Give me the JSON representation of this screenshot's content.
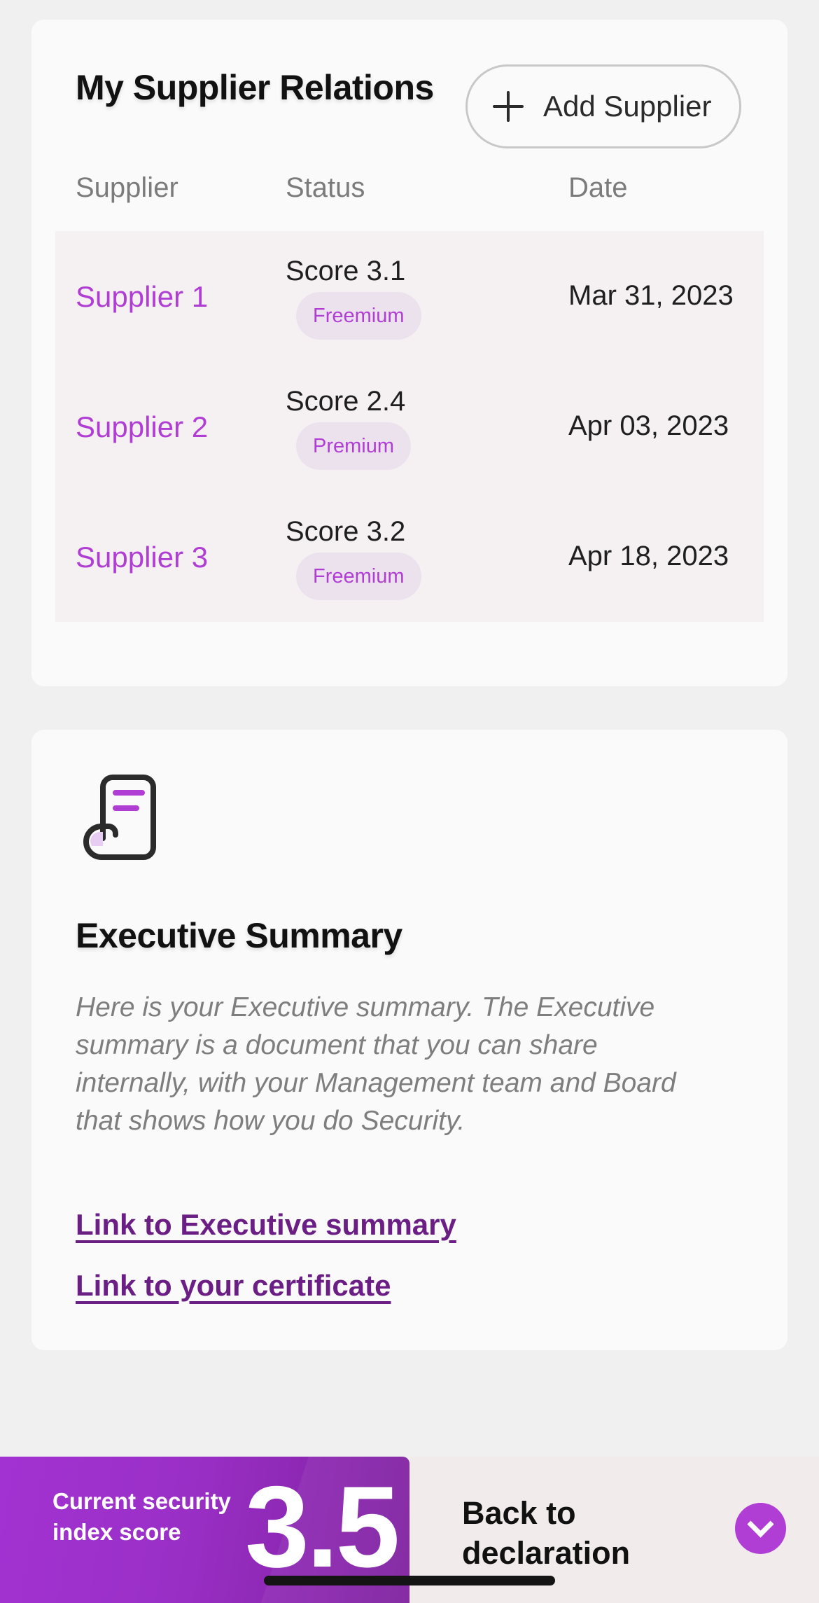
{
  "suppliers": {
    "title": "My Supplier Relations",
    "add_button_label": "Add Supplier",
    "columns": [
      "Supplier",
      "Status",
      "Date"
    ],
    "rows": [
      {
        "name": "Supplier 1",
        "score": "Score 3.1",
        "tier": "Freemium",
        "date": "Mar 31, 2023"
      },
      {
        "name": "Supplier 2",
        "score": "Score 2.4",
        "tier": "Premium",
        "date": "Apr 03, 2023"
      },
      {
        "name": "Supplier 3",
        "score": "Score 3.2",
        "tier": "Freemium",
        "date": "Apr 18, 2023"
      }
    ]
  },
  "summary": {
    "icon": "document-scroll-icon",
    "title": "Executive Summary",
    "text": "Here is your Executive summary. The Executive summary is a document that you can share internally, with your Management team and Board that shows how you do Security.",
    "exec_link": "Link to Executive summary",
    "cert_link": "Link to your certificate"
  },
  "footer": {
    "score_label": "Current security index score",
    "score_value": "3.5",
    "back_label": "Back to declaration"
  },
  "colors": {
    "accent": "#b03ed4",
    "link": "#6b1f85",
    "score_panel": "#9a2fc6",
    "background": "#f1f0f0"
  }
}
